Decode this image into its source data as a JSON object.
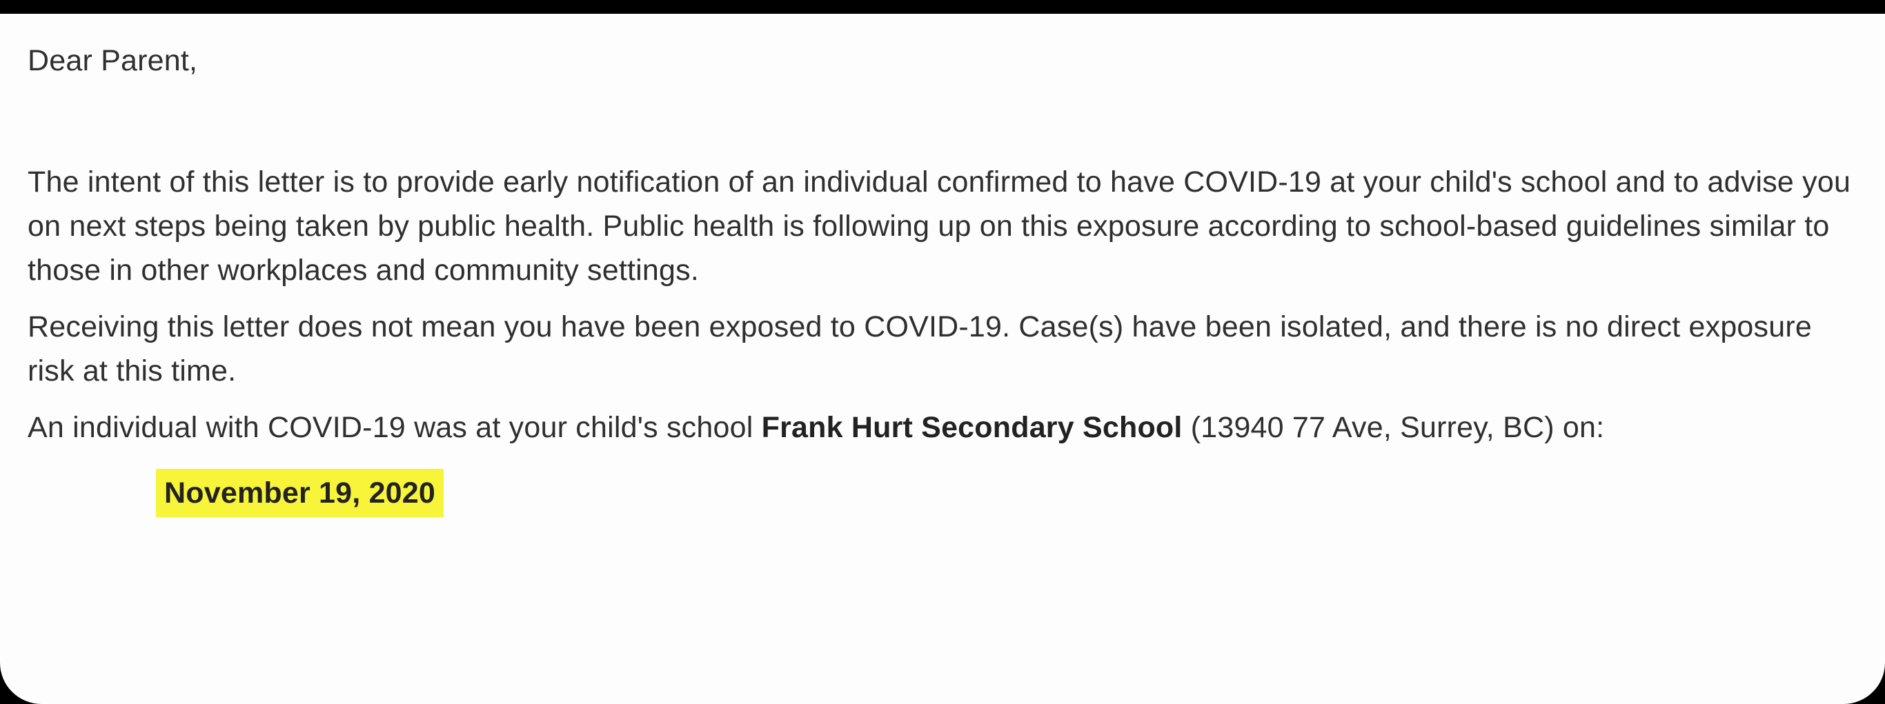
{
  "letter": {
    "salutation": "Dear Parent,",
    "paragraph_intent": "The intent of this letter is to provide early notification of an individual confirmed to have COVID-19 at your child's school and to advise you on next steps being taken by public health. Public health is following up on this exposure according to school-based guidelines similar to those in other workplaces and community settings.",
    "paragraph_receiving": "Receiving this letter does not mean you have been exposed to COVID-19. Case(s) have been isolated, and there is no direct exposure risk at this time.",
    "paragraph_individual_prefix": "An individual with COVID-19 was at your child's school ",
    "school_name": "Frank Hurt Secondary School",
    "paragraph_individual_suffix": " (13940 77 Ave, Surrey, BC) on:",
    "exposure_date": "November 19, 2020",
    "highlight_color": "#f7f43a"
  }
}
